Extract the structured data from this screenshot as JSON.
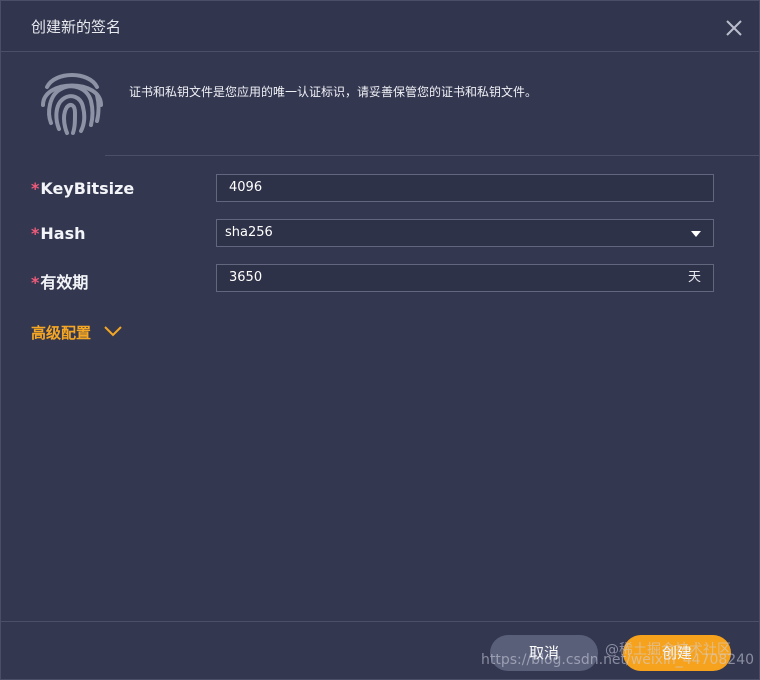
{
  "dialog": {
    "title": "创建新的签名",
    "close_icon": "close-icon"
  },
  "intro": {
    "icon": "fingerprint-icon",
    "text": "证书和私钥文件是您应用的唯一认证标识，请妥善保管您的证书和私钥文件。"
  },
  "form": {
    "required_mark": "*",
    "keybitsize": {
      "label": "KeyBitsize",
      "value": "4096"
    },
    "hash": {
      "label": "Hash",
      "value": "sha256"
    },
    "validity": {
      "label": "有效期",
      "value": "3650",
      "suffix": "天"
    }
  },
  "advanced": {
    "label": "高级配置",
    "icon": "chevron-down-icon"
  },
  "footer": {
    "cancel_label": "取消",
    "create_label": "创建"
  },
  "watermarks": {
    "url": "https://blog.csdn.net/weixin_44708240",
    "community": "@稀土掘金技术社区"
  },
  "colors": {
    "background": "#333750",
    "accent": "#f6a21c",
    "required": "#f05b7a",
    "cancel_button": "#5a5f79"
  }
}
